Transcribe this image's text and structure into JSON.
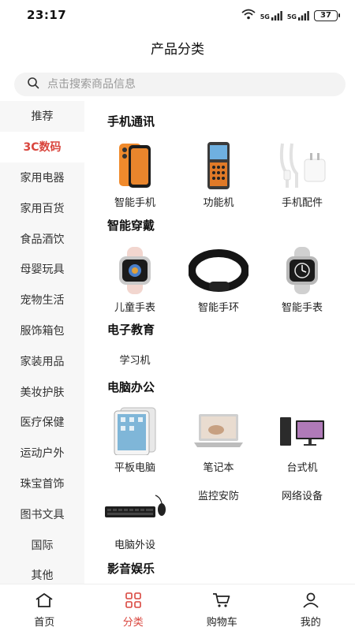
{
  "status": {
    "time": "23:17",
    "battery": "37",
    "net1": "5G",
    "net2": "5G"
  },
  "header": {
    "title": "产品分类"
  },
  "search": {
    "placeholder": "点击搜索商品信息"
  },
  "sidebar": {
    "items": [
      {
        "label": "推荐"
      },
      {
        "label": "3C数码"
      },
      {
        "label": "家用电器"
      },
      {
        "label": "家用百货"
      },
      {
        "label": "食品酒饮"
      },
      {
        "label": "母婴玩具"
      },
      {
        "label": "宠物生活"
      },
      {
        "label": "服饰箱包"
      },
      {
        "label": "家装用品"
      },
      {
        "label": "美妆护肤"
      },
      {
        "label": "医疗保健"
      },
      {
        "label": "运动户外"
      },
      {
        "label": "珠宝首饰"
      },
      {
        "label": "图书文具"
      },
      {
        "label": "国际"
      },
      {
        "label": "其他"
      }
    ],
    "active_index": 1
  },
  "sections": {
    "phones": {
      "title": "手机通讯",
      "items": [
        "智能手机",
        "功能机",
        "手机配件"
      ]
    },
    "wearables": {
      "title": "智能穿戴",
      "items": [
        "儿童手表",
        "智能手环",
        "智能手表"
      ]
    },
    "education": {
      "title": "电子教育",
      "items": [
        "学习机"
      ]
    },
    "office": {
      "title": "电脑办公",
      "items": [
        "平板电脑",
        "笔记本",
        "台式机",
        "监控安防",
        "网络设备",
        "电脑外设"
      ]
    },
    "entertainment": {
      "title": "影音娱乐"
    }
  },
  "tabbar": {
    "items": [
      {
        "label": "首页"
      },
      {
        "label": "分类"
      },
      {
        "label": "购物车"
      },
      {
        "label": "我的"
      }
    ],
    "active_index": 1
  },
  "colors": {
    "accent": "#d9463e",
    "sidebar_bg": "#f7f7f7",
    "search_bg": "#f3f3f3"
  }
}
